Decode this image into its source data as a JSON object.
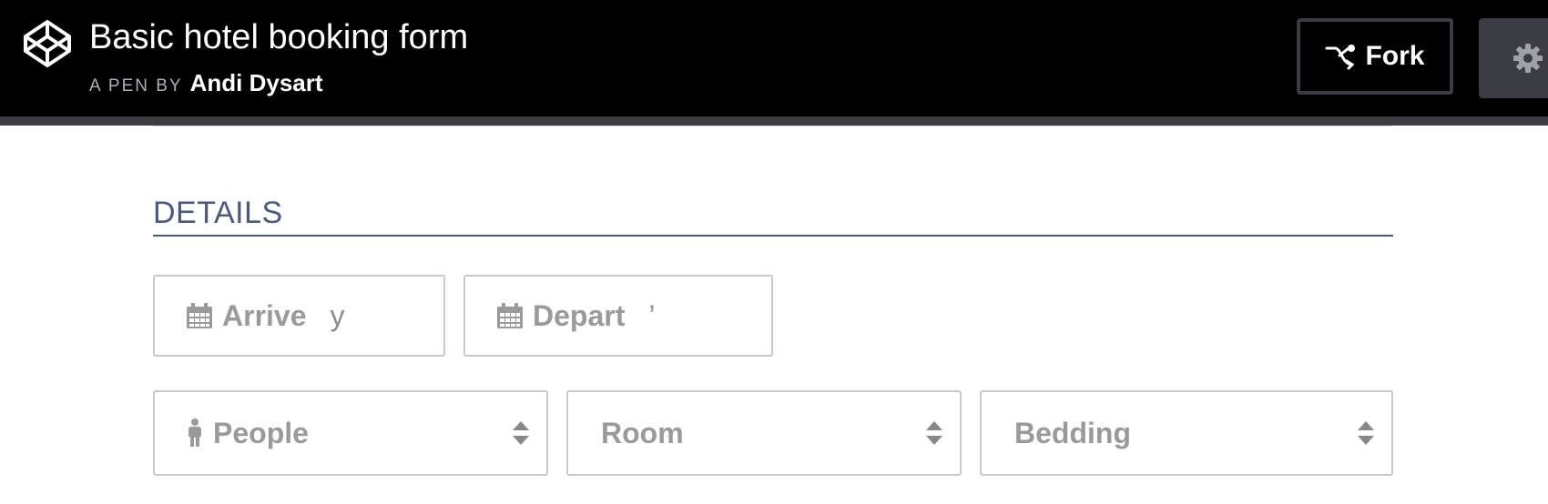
{
  "header": {
    "title": "Basic hotel booking form",
    "byline_prefix": "A PEN BY",
    "author": "Andi Dysart",
    "fork_label": "Fork",
    "logo_icon": "codepen-logo-icon",
    "settings_icon": "gear-icon"
  },
  "form": {
    "section_heading": "DETAILS",
    "arrive": {
      "label": "Arrive",
      "ghost_text": "y",
      "icon": "calendar-icon"
    },
    "depart": {
      "label": "Depart",
      "ghost_text": "’",
      "icon": "calendar-icon"
    },
    "people": {
      "label": "People",
      "icon": "person-icon"
    },
    "room": {
      "label": "Room"
    },
    "bedding": {
      "label": "Bedding"
    }
  },
  "colors": {
    "topbar": "#000000",
    "strip": "#3b3d43",
    "heading": "#4a5a78",
    "field_text": "#9a9a9a",
    "field_border": "#c8c8c8"
  }
}
